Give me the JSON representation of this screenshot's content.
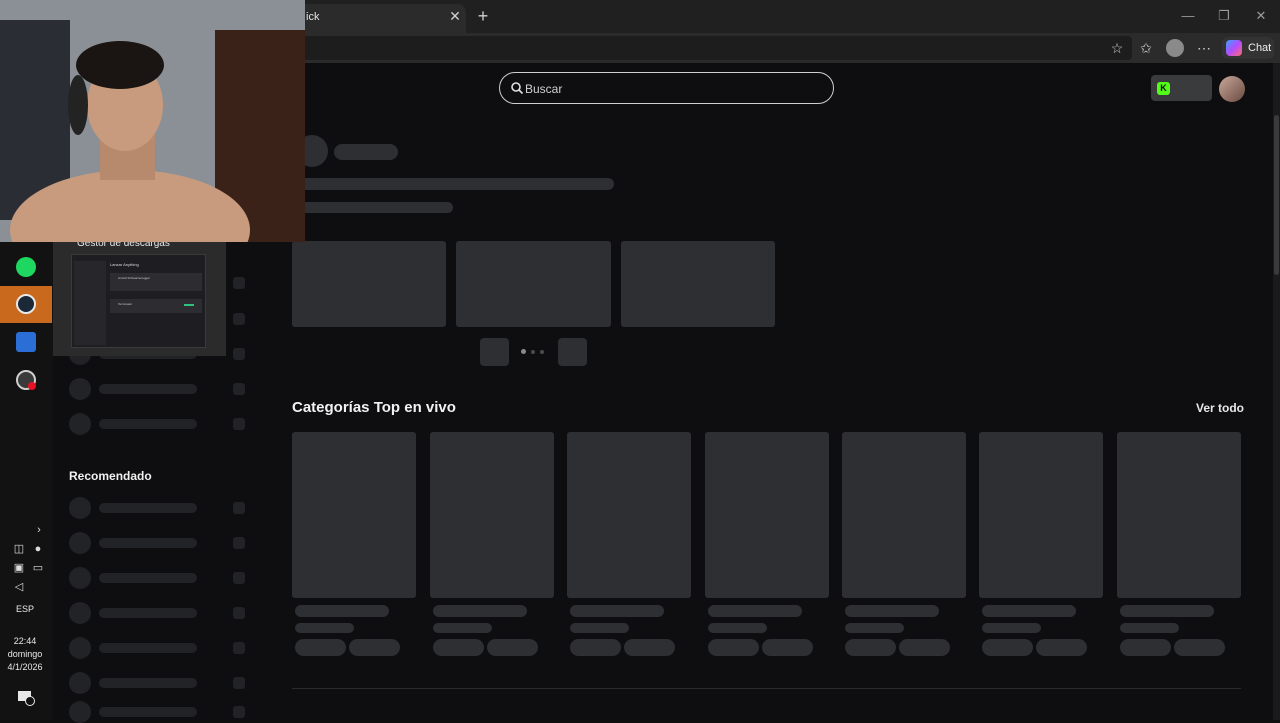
{
  "browser": {
    "tab_title": "ick",
    "tab_close": "✕",
    "new_tab": "+",
    "chat_label": "Chat",
    "window_buttons": [
      "—",
      "❐",
      "✕"
    ]
  },
  "header": {
    "search_placeholder": "Buscar"
  },
  "sidebar": {
    "recommended_title": "Recomendado"
  },
  "main": {
    "categories_title": "Categorías Top en vivo",
    "see_all": "Ver todo"
  },
  "download_manager": {
    "title": "Gestor de descargas",
    "panel_heading": "Lanzar Anything",
    "items": [
      "Arnold Schwarzenegger",
      "Terminator"
    ]
  },
  "taskbar": {
    "apps": [
      "spotify-icon",
      "steam-icon",
      "kick-app-icon",
      "obs-icon"
    ],
    "language": "ESP",
    "time": "22:44",
    "day": "domingo",
    "date": "4/1/2026"
  },
  "colors": {
    "kick_green": "#53fc18",
    "steam_active": "#c8691e",
    "skeleton": "#2e2f33",
    "page_bg": "#0e0e10"
  }
}
